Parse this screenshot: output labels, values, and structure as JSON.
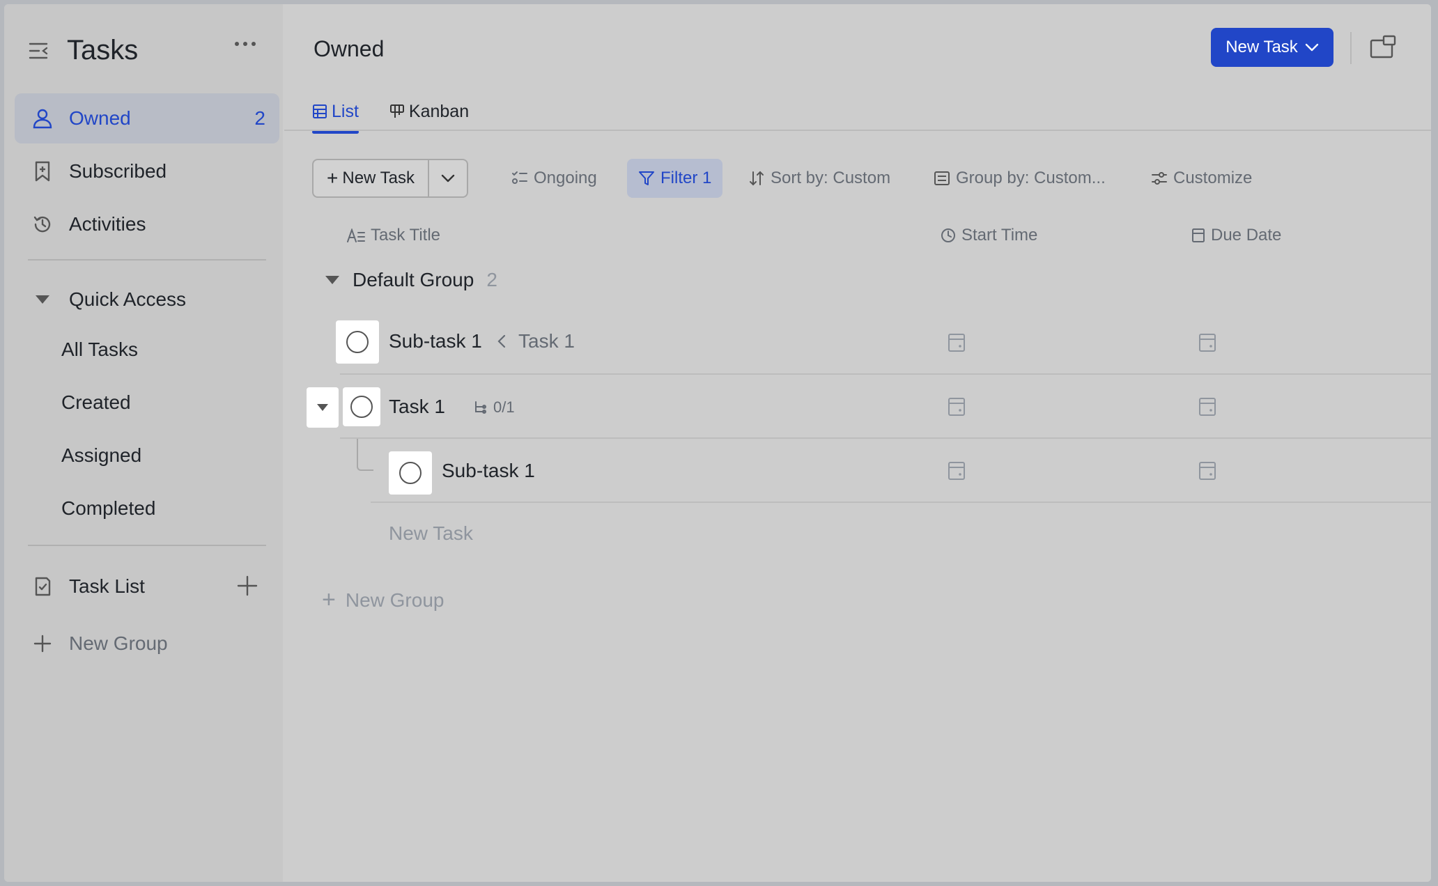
{
  "sidebar": {
    "title": "Tasks",
    "nav": [
      {
        "label": "Owned",
        "count": "2",
        "icon": "person-icon"
      },
      {
        "label": "Subscribed",
        "icon": "bookmark-icon"
      },
      {
        "label": "Activities",
        "icon": "history-icon"
      }
    ],
    "quick_access": {
      "label": "Quick Access",
      "items": [
        "All Tasks",
        "Created",
        "Assigned",
        "Completed"
      ]
    },
    "task_list": {
      "label": "Task List"
    },
    "new_group": "New Group"
  },
  "main": {
    "title": "Owned",
    "new_task_button": "New Task",
    "tabs": [
      {
        "label": "List",
        "icon": "table-icon"
      },
      {
        "label": "Kanban",
        "icon": "kanban-icon"
      }
    ],
    "toolbar": {
      "new_task": "New Task",
      "ongoing": "Ongoing",
      "filter": "Filter 1",
      "sort": "Sort by: Custom",
      "group": "Group by: Custom...",
      "customize": "Customize"
    },
    "columns": {
      "title": "Task Title",
      "start": "Start Time",
      "due": "Due Date"
    },
    "group": {
      "name": "Default Group",
      "count": "2"
    },
    "rows": [
      {
        "title": "Sub-task 1",
        "parent": "Task 1"
      },
      {
        "title": "Task 1",
        "subtasks": "0/1"
      },
      {
        "title": "Sub-task 1"
      }
    ],
    "new_task_inline": "New Task",
    "new_group": "New Group"
  },
  "colors": {
    "accent": "#2146c7",
    "background": "#cdcdcd"
  }
}
